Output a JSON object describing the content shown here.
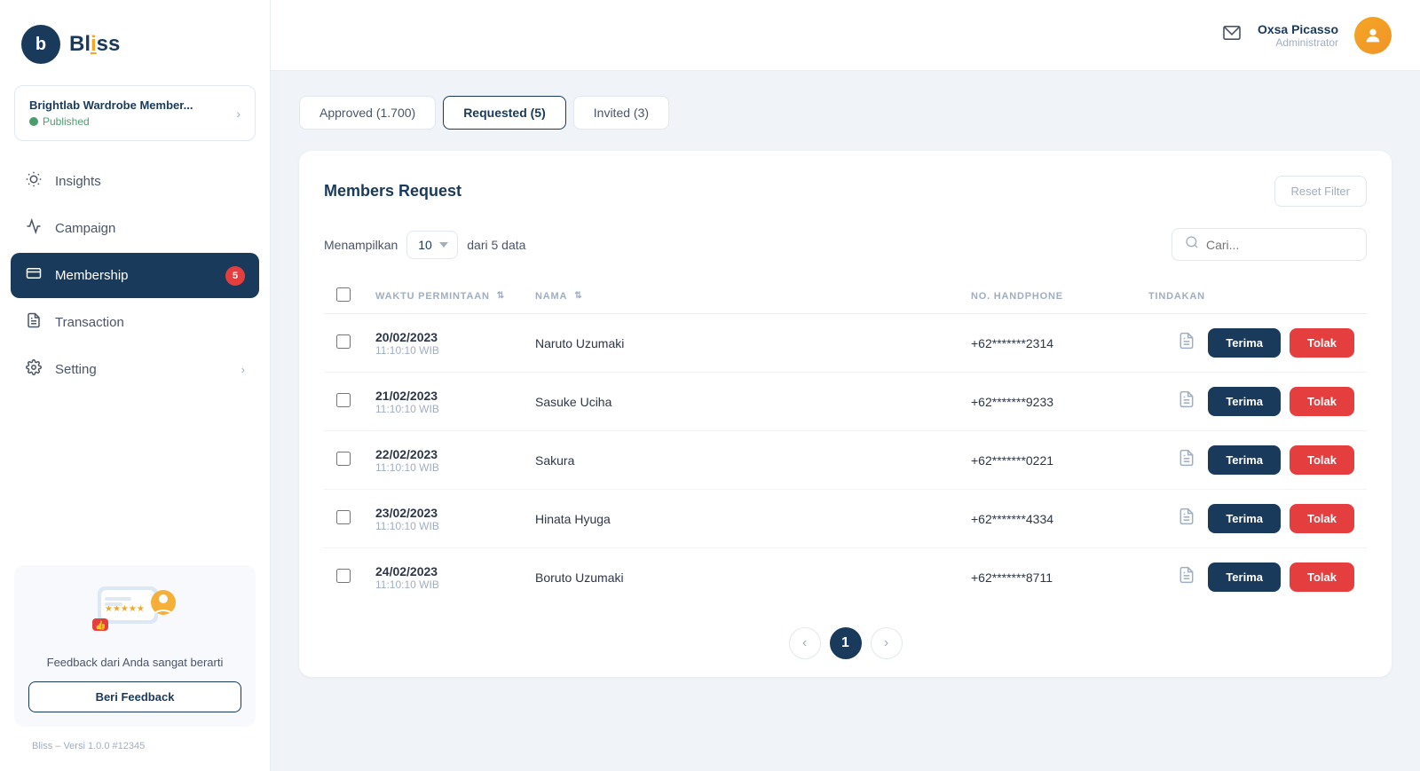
{
  "app": {
    "logo_letter": "b",
    "logo_name": "Bliss",
    "version": "Bliss – Versi 1.0.0 #12345"
  },
  "workspace": {
    "name": "Brightlab Wardrobe Member...",
    "status": "Published"
  },
  "sidebar": {
    "nav_items": [
      {
        "id": "insights",
        "label": "Insights",
        "icon": "💡",
        "active": false,
        "badge": null,
        "has_chevron": false
      },
      {
        "id": "campaign",
        "label": "Campaign",
        "icon": "📣",
        "active": false,
        "badge": null,
        "has_chevron": false
      },
      {
        "id": "membership",
        "label": "Membership",
        "icon": "🪪",
        "active": true,
        "badge": "5",
        "has_chevron": false
      },
      {
        "id": "transaction",
        "label": "Transaction",
        "icon": "🧾",
        "active": false,
        "badge": null,
        "has_chevron": false
      },
      {
        "id": "setting",
        "label": "Setting",
        "icon": "⚙️",
        "active": false,
        "badge": null,
        "has_chevron": true
      }
    ],
    "feedback": {
      "text": "Feedback dari Anda\nsangat berarti",
      "button_label": "Beri Feedback"
    }
  },
  "topbar": {
    "user_name": "Oxsa Picasso",
    "user_role": "Administrator"
  },
  "tabs": [
    {
      "id": "approved",
      "label": "Approved (1.700)",
      "active": false
    },
    {
      "id": "requested",
      "label": "Requested (5)",
      "active": true
    },
    {
      "id": "invited",
      "label": "Invited (3)",
      "active": false
    }
  ],
  "table_section": {
    "title": "Members Request",
    "reset_filter_label": "Reset Filter",
    "menampilkan_label": "Menampilkan",
    "per_page": "10",
    "data_count": "dari 5 data",
    "search_placeholder": "Cari...",
    "columns": [
      {
        "id": "waktu",
        "label": "WAKTU PERMINTAAN",
        "sortable": true
      },
      {
        "id": "nama",
        "label": "NAMA",
        "sortable": true
      },
      {
        "id": "phone",
        "label": "NO. HANDPHONE",
        "sortable": false
      },
      {
        "id": "tindakan",
        "label": "TINDAKAN",
        "sortable": false
      }
    ],
    "rows": [
      {
        "id": 1,
        "date": "20/02/2023",
        "time": "11:10:10 WIB",
        "name": "Naruto Uzumaki",
        "phone": "+62*******2314"
      },
      {
        "id": 2,
        "date": "21/02/2023",
        "time": "11:10:10 WIB",
        "name": "Sasuke Uciha",
        "phone": "+62*******9233"
      },
      {
        "id": 3,
        "date": "22/02/2023",
        "time": "11:10:10 WIB",
        "name": "Sakura",
        "phone": "+62*******0221"
      },
      {
        "id": 4,
        "date": "23/02/2023",
        "time": "11:10:10 WIB",
        "name": "Hinata Hyuga",
        "phone": "+62*******4334"
      },
      {
        "id": 5,
        "date": "24/02/2023",
        "time": "11:10:10 WIB",
        "name": "Boruto Uzumaki",
        "phone": "+62*******8711"
      }
    ],
    "btn_terima": "Terima",
    "btn_tolak": "Tolak",
    "pagination": {
      "current": 1,
      "pages": [
        1
      ]
    }
  },
  "colors": {
    "primary": "#1a3a5c",
    "danger": "#e53e3e",
    "success": "#4a9d6f"
  }
}
